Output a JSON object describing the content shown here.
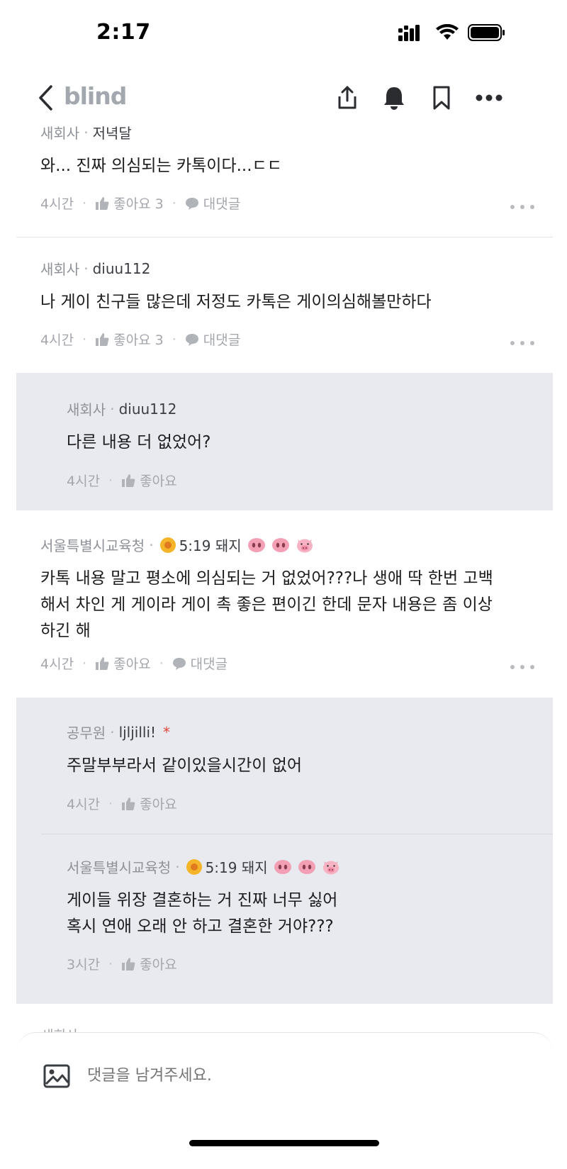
{
  "status_bar": {
    "time": "2:17"
  },
  "header": {
    "logo": "blind"
  },
  "comments": [
    {
      "company": "새회사",
      "nick": "저녁달",
      "text": [
        "와... 진짜 의심되는 카톡이다...ㄷㄷ"
      ],
      "time": "4시간",
      "like": "좋아요 3",
      "reply": "대댓글"
    },
    {
      "company": "새회사",
      "nick": "diuu112",
      "text": [
        "나 게이 친구들 많은데 저정도 카톡은 게이의심해볼만하다"
      ],
      "time": "4시간",
      "like": "좋아요 3",
      "reply": "대댓글"
    },
    {
      "company": "새회사",
      "nick": "diuu112",
      "text": [
        "다른 내용 더 없었어?"
      ],
      "time": "4시간",
      "like": "좋아요"
    },
    {
      "company": "서울특별시교육청",
      "nick": "5:19 돼지",
      "text": [
        "카톡 내용 말고 평소에 의심되는 거 없었어???나 생애 딱 한번 고백",
        "해서 차인 게 게이라 게이 촉 좋은 편이긴 한데 문자 내용은 좀 이상",
        "하긴 해"
      ],
      "time": "4시간",
      "like": "좋아요",
      "reply": "대댓글"
    },
    {
      "company": "공무원",
      "nick": "ljljilli!",
      "text": [
        "주말부부라서 같이있을시간이 없어"
      ],
      "time": "4시간",
      "like": "좋아요"
    },
    {
      "company": "서울특별시교육청",
      "nick": "5:19 돼지",
      "text": [
        "게이들 위장 결혼하는 거 진짜 너무 싫어",
        "혹시 연애 오래 안 하고 결혼한 거야???"
      ],
      "time": "3시간",
      "like": "좋아요"
    }
  ],
  "peek": {
    "company": "새회사"
  },
  "compose": {
    "placeholder": "댓글을 남겨주세요."
  },
  "colors": {
    "reply_bg": "#e9eaef",
    "meta": "#8e9298",
    "logo": "#a3a7ae"
  }
}
